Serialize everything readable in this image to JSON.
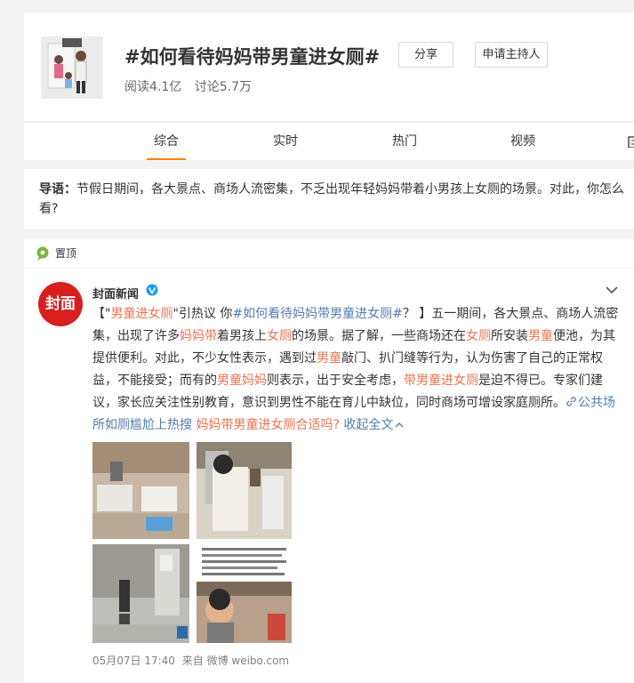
{
  "topic": {
    "title": "#如何看待妈妈带男童进女厕#",
    "reads": "阅读4.1亿",
    "discussions": "讨论5.7万",
    "share_label": "分享",
    "host_label": "申请主持人"
  },
  "tabs": [
    "综合",
    "实时",
    "热门",
    "视频"
  ],
  "intro": {
    "label": "导语：",
    "text": "节假日期间，各大景点、商场人流密集，不乏出现年轻妈妈带着小男孩上女厕的场景。对此，你怎么看?"
  },
  "post": {
    "pin_label": "置顶",
    "avatar_text": "封面",
    "author": "封面新闻",
    "body": {
      "s01": "【\"",
      "s02": "男童进女厕",
      "s03": "\"引热议 你",
      "s04": "#如何看待妈妈带男童进女厕#",
      "s05": "？ 】五一期间，各大景点、商场人流密集，出现了许多",
      "s06": "妈妈带",
      "s07": "着男孩上",
      "s08": "女厕",
      "s09": "的场景。据了解，一些商场还在",
      "s10": "女厕",
      "s11": "所安装",
      "s12": "男童",
      "s13": "便池，为其提供便利。对此，不少女性表示，遇到过",
      "s14": "男童",
      "s15": "敲门、扒门缝等行为，认为伤害了自己的正常权益，不能接受；而有的",
      "s16": "男童妈妈",
      "s17": "则表示，出于安全考虑，",
      "s18": "带男童进女厕",
      "s19": "是迫不得已。专家们建议，家长应关注性别教育，意识到男性不能在育儿中缺位，同时商场可增设家庭厕所。",
      "s20": "公共场所如厕尴尬上热搜",
      "s21": " ",
      "s22": "妈妈带男童进女厕合适吗?",
      "s23": " 收起全文"
    },
    "meta_date": "05月07日 17:40",
    "meta_source": "来自 微博 weibo.com"
  },
  "colors": {
    "accent_orange": "#ff8200",
    "highlight": "#eb7350",
    "link": "#507daf",
    "brand_red": "#d7201e"
  }
}
